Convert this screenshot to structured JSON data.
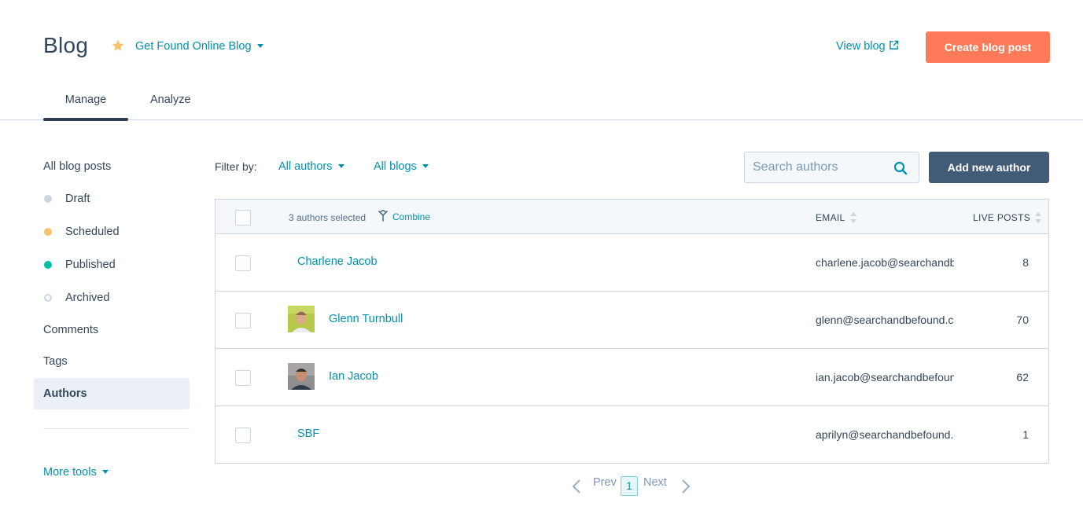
{
  "header": {
    "title": "Blog",
    "blog_switcher": "Get Found Online Blog",
    "view_blog": "View blog",
    "create_button": "Create blog post"
  },
  "tabs": [
    {
      "label": "Manage",
      "active": true
    },
    {
      "label": "Analyze",
      "active": false
    }
  ],
  "sidebar": {
    "items": [
      {
        "label": "All blog posts"
      },
      {
        "label": "Draft",
        "dot_color": "#cbd6e2"
      },
      {
        "label": "Scheduled",
        "dot_color": "#f5c26b"
      },
      {
        "label": "Published",
        "dot_color": "#00bda5"
      },
      {
        "label": "Archived",
        "dot_color": "hollow"
      },
      {
        "label": "Comments"
      },
      {
        "label": "Tags"
      },
      {
        "label": "Authors",
        "active": true
      }
    ],
    "more_tools": "More tools"
  },
  "filters": {
    "label": "Filter by:",
    "authors": "All authors",
    "blogs": "All blogs"
  },
  "search": {
    "placeholder": "Search authors",
    "value": ""
  },
  "add_author_button": "Add new author",
  "table": {
    "selected_text": "3 authors selected",
    "combine_label": "Combine",
    "columns": {
      "email": "EMAIL",
      "live_posts": "LIVE POSTS"
    },
    "rows": [
      {
        "name": "Charlene Jacob",
        "email": "charlene.jacob@searchandbefound.com",
        "live_posts": "8",
        "avatar": false
      },
      {
        "name": "Glenn Turnbull",
        "email": "glenn@searchandbefound.com",
        "live_posts": "70",
        "avatar": true
      },
      {
        "name": "Ian Jacob",
        "email": "ian.jacob@searchandbefound.com",
        "live_posts": "62",
        "avatar": true
      },
      {
        "name": "SBF",
        "email": "aprilyn@searchandbefound.com",
        "live_posts": "1",
        "avatar": false
      }
    ]
  },
  "pagination": {
    "prev": "Prev",
    "current": "1",
    "next": "Next"
  },
  "colors": {
    "accent": "#0091ae",
    "primary_button": "#ff7a59",
    "secondary_button": "#425b76",
    "text": "#33475b"
  }
}
